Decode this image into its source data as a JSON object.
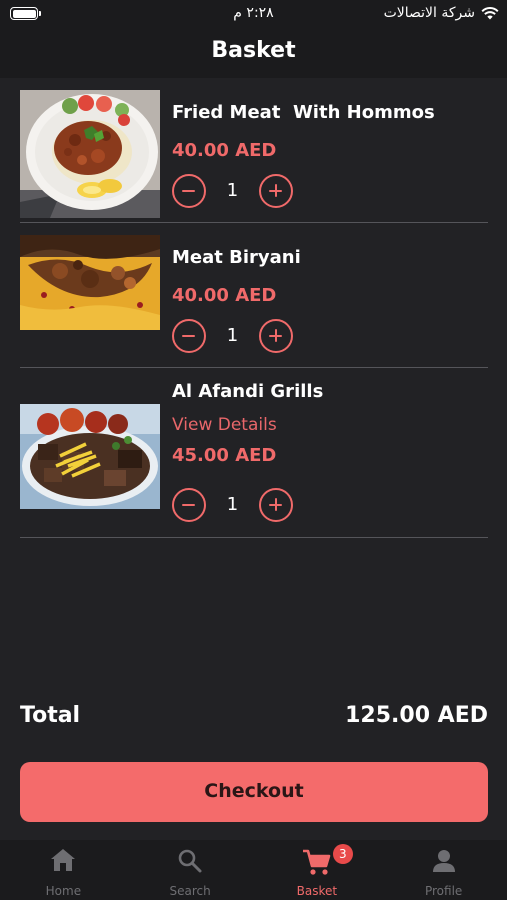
{
  "status_bar": {
    "time": "٢:٢٨ م",
    "carrier": "شركة الاتصالات"
  },
  "header": {
    "title": "Basket"
  },
  "items": [
    {
      "name": "Fried Meat  With Hommos",
      "price": "40.00 AED",
      "quantity": "1",
      "link": ""
    },
    {
      "name": "Meat Biryani",
      "price": "40.00 AED",
      "quantity": "1",
      "link": ""
    },
    {
      "name": "Al Afandi Grills",
      "link": "View Details",
      "price": "45.00 AED",
      "quantity": "1"
    }
  ],
  "summary": {
    "total_label": "Total",
    "total_value": "125.00 AED"
  },
  "checkout_label": "Checkout",
  "tabs": [
    {
      "label": "Home",
      "icon": "home-icon"
    },
    {
      "label": "Search",
      "icon": "search-icon"
    },
    {
      "label": "Basket",
      "icon": "cart-icon",
      "badge": "3"
    },
    {
      "label": "Profile",
      "icon": "profile-icon"
    }
  ],
  "colors": {
    "background": "#222225",
    "bar": "#1b1b1d",
    "accent": "#f06a6a",
    "checkout": "#f46b6b",
    "tab_inactive": "#6e6e72"
  }
}
